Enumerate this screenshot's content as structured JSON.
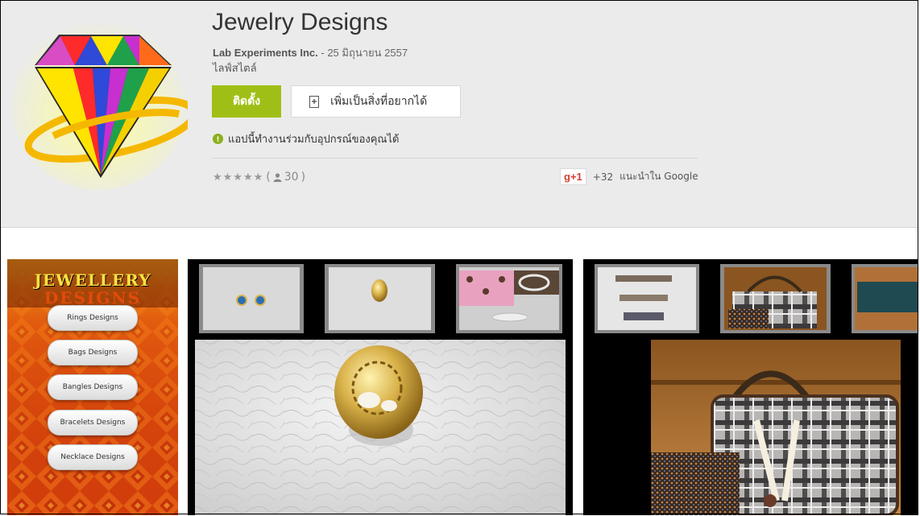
{
  "app": {
    "title": "Jewelry Designs",
    "developer": "Lab Experiments Inc.",
    "separator": " - ",
    "date": "25 มิถุนายน 2557",
    "category": "ไลฟ์สไตล์"
  },
  "actions": {
    "install_label": "ติดตั้ง",
    "wishlist_label": "เพิ่มเป็นสิ่งที่อยากได้"
  },
  "compatibility": {
    "text": "แอปนี้ทำงานร่วมกับอุปกรณ์ของคุณได้"
  },
  "rating": {
    "stars": "★★★★★",
    "open_paren": "(",
    "count": "30",
    "close_paren": ")"
  },
  "gplus": {
    "button_label": "g+1",
    "count": "+32",
    "text": "แนะนำใน Google"
  },
  "screenshot1": {
    "logo_line1": "JEWELLERY",
    "logo_line2": "DESIGNS",
    "menu_items": [
      "Rings Designs",
      "Bags Designs",
      "Bangles Designs",
      "Bracelets Designs",
      "Necklace Designs"
    ]
  },
  "icons": {
    "app_icon": "diamond-icon",
    "wishlist_icon": "bookmark-add-icon",
    "compat_icon": "check-circle-icon",
    "rating_person": "person-icon"
  },
  "colors": {
    "install": "#a0bf16",
    "compat": "#8bb01a",
    "gplus": "#d73d32"
  }
}
